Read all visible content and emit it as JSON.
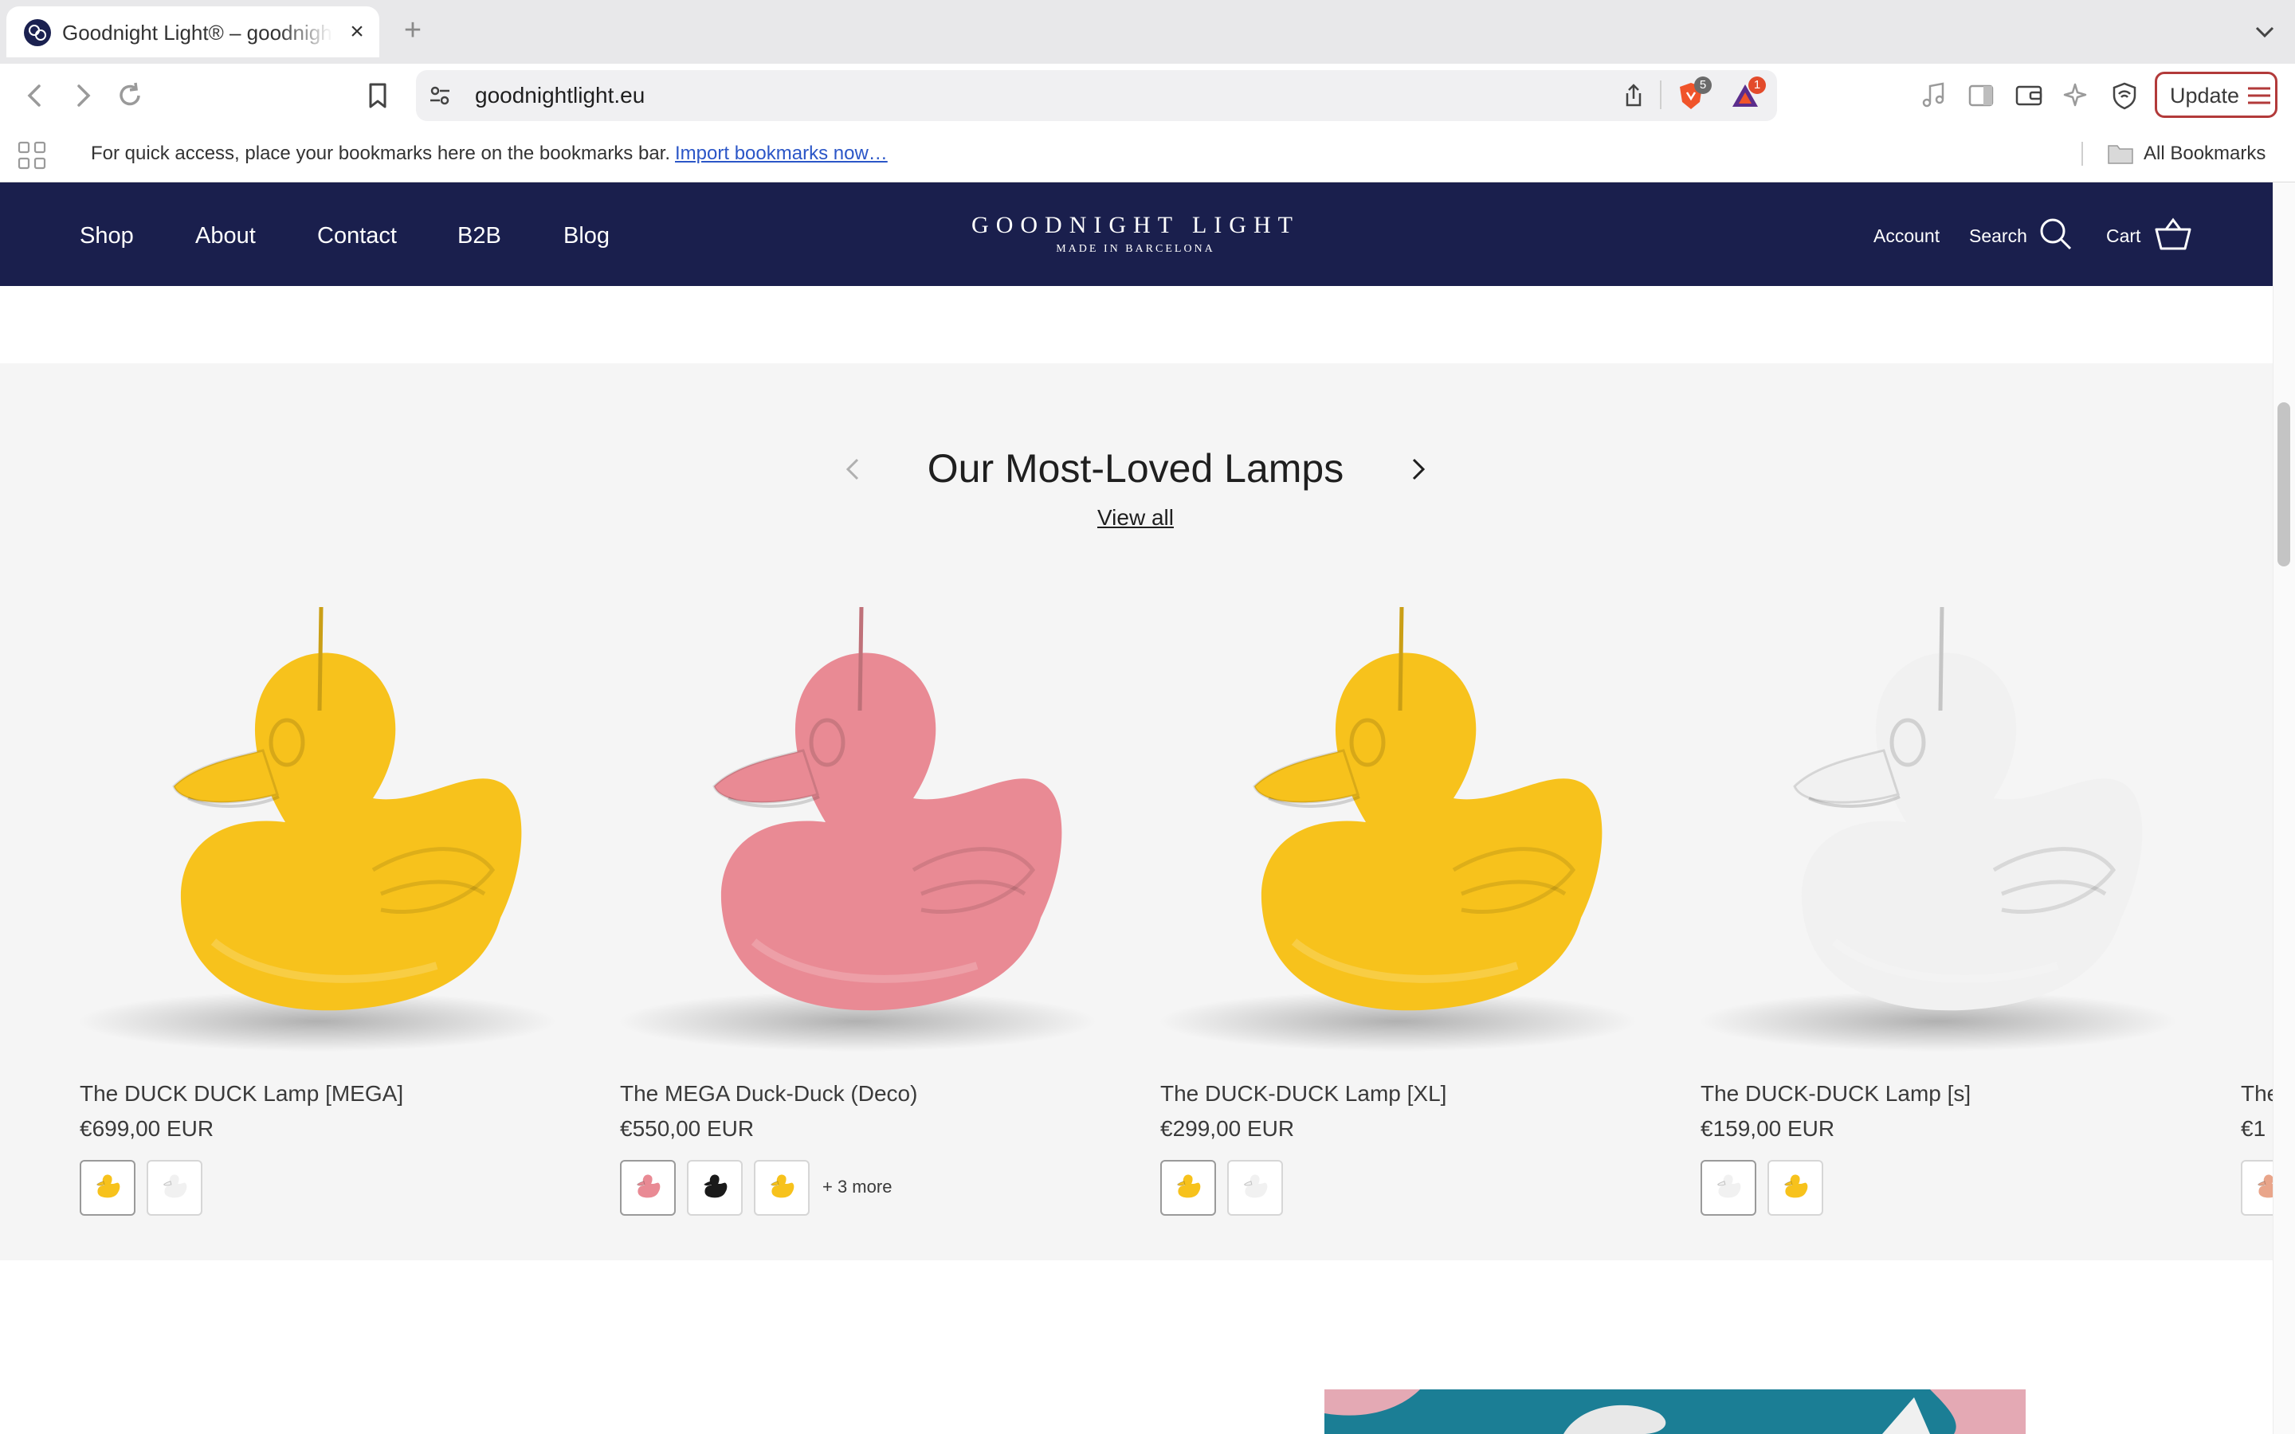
{
  "browser": {
    "tab_title": "Goodnight Light® – goodnightlight.eu",
    "tab_close": "×",
    "new_tab": "+",
    "url": "goodnightlight.eu",
    "shields_count": "5",
    "alert_count": "1",
    "update_label": "Update"
  },
  "bookmarks_bar": {
    "message": "For quick access, place your bookmarks here on the bookmarks bar.",
    "import_link": "Import bookmarks now…",
    "all_bookmarks": "All Bookmarks"
  },
  "site": {
    "nav": [
      "Shop",
      "About",
      "Contact",
      "B2B",
      "Blog"
    ],
    "logo_title": "GOODNIGHT LIGHT",
    "logo_subtitle": "MADE IN BARCELONA",
    "account": "Account",
    "search": "Search",
    "cart": "Cart"
  },
  "carousel": {
    "title": "Our Most-Loved Lamps",
    "view_all": "View all",
    "products": [
      {
        "name": "The DUCK DUCK Lamp [MEGA]",
        "price": "€699,00 EUR",
        "color": "#f7c21c",
        "swatches": [
          "yellow",
          "white"
        ]
      },
      {
        "name": "The MEGA Duck-Duck (Deco)",
        "price": "€550,00 EUR",
        "color": "#e98a94",
        "swatches": [
          "pink",
          "black",
          "yellow"
        ],
        "more": "+ 3 more"
      },
      {
        "name": "The DUCK-DUCK Lamp [XL]",
        "price": "€299,00 EUR",
        "color": "#f7c21c",
        "swatches": [
          "yellow",
          "white"
        ]
      },
      {
        "name": "The DUCK-DUCK Lamp [s]",
        "price": "€159,00 EUR",
        "color": "#f1f1f1",
        "swatches": [
          "white",
          "yellow"
        ]
      },
      {
        "name": "The",
        "price": "€1"
      }
    ]
  }
}
